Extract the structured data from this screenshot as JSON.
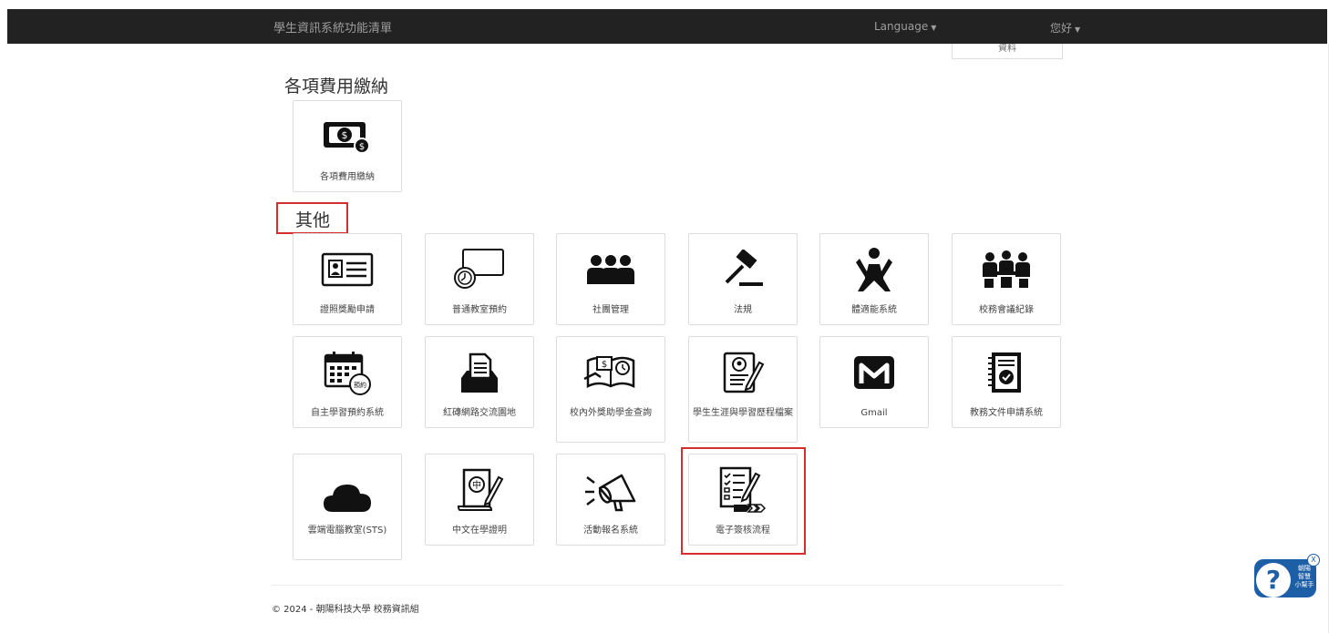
{
  "navbar": {
    "brand": "學生資訊系統功能清單",
    "language_label": "Language",
    "user_greeting": "您好"
  },
  "partial_tile_text": "資料",
  "fees_section": {
    "title": "各項費用繳納",
    "tiles": [
      {
        "label": "各項費用繳納",
        "icon": "money-icon"
      }
    ]
  },
  "other_section": {
    "title": "其他",
    "tiles": [
      {
        "label": "證照獎勵申請",
        "icon": "id-card-icon"
      },
      {
        "label": "普通教室預約",
        "icon": "classroom-clock-icon"
      },
      {
        "label": "社團管理",
        "icon": "group-icon"
      },
      {
        "label": "法規",
        "icon": "gavel-icon"
      },
      {
        "label": "體適能系統",
        "icon": "fitness-icon"
      },
      {
        "label": "校務會議紀錄",
        "icon": "meeting-icon"
      },
      {
        "label": "自主學習預約系統",
        "icon": "calendar-booking-icon",
        "badge": "預約"
      },
      {
        "label": "紅磚網路交流園地",
        "icon": "inbox-document-icon"
      },
      {
        "label": "校內外獎助學金查詢",
        "icon": "scholarship-book-icon"
      },
      {
        "label": "學生生涯與學習歷程檔案",
        "icon": "portfolio-icon"
      },
      {
        "label": "Gmail",
        "icon": "gmail-icon"
      },
      {
        "label": "教務文件申請系統",
        "icon": "document-check-icon"
      },
      {
        "label": "雲端電腦教室(STS)",
        "icon": "cloud-icon"
      },
      {
        "label": "中文在學證明",
        "icon": "chinese-certificate-icon",
        "badge": "中"
      },
      {
        "label": "活動報名系統",
        "icon": "megaphone-icon"
      },
      {
        "label": "電子簽核流程",
        "icon": "checklist-pen-icon"
      }
    ]
  },
  "footer": {
    "copyright": "© 2024 - 朝陽科技大學 校務資訊組"
  },
  "helper_widget": {
    "line1": "朝陽",
    "line2": "智慧",
    "line3": "小幫手",
    "close": "X",
    "symbol": "?"
  },
  "colors": {
    "navbar": "#222222",
    "highlight": "#d32f2f",
    "helper": "#1d5fa6"
  }
}
